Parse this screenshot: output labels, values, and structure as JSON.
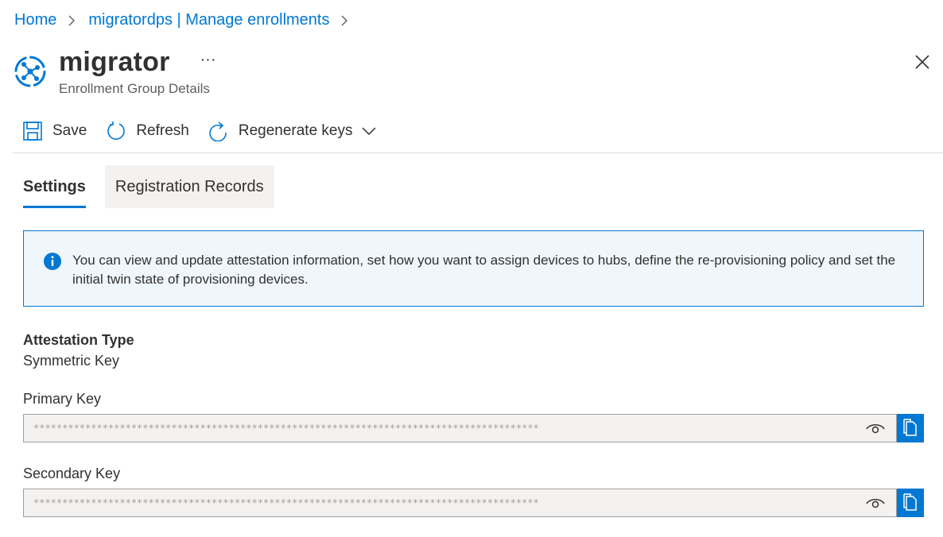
{
  "breadcrumb": {
    "items": [
      "Home",
      "migratordps | Manage enrollments"
    ]
  },
  "header": {
    "title": "migrator",
    "more": "···",
    "subtitle": "Enrollment Group Details",
    "icon": "device-provisioning-icon"
  },
  "toolbar": {
    "save_label": "Save",
    "refresh_label": "Refresh",
    "regenerate_label": "Regenerate keys"
  },
  "tabs": [
    {
      "label": "Settings",
      "active": true
    },
    {
      "label": "Registration Records",
      "active": false
    }
  ],
  "info": {
    "text": "You can view and update attestation information, set how you want to assign devices to hubs, define the re-provisioning policy and set the initial twin state of provisioning devices."
  },
  "attestation": {
    "label": "Attestation Type",
    "value": "Symmetric Key"
  },
  "primary_key": {
    "label": "Primary Key",
    "masked_value": "****************************************************************************************"
  },
  "secondary_key": {
    "label": "Secondary Key",
    "masked_value": "****************************************************************************************"
  },
  "colors": {
    "accent": "#0078d4",
    "info_bg": "#eff6fc",
    "input_bg": "#f3f2f1"
  }
}
